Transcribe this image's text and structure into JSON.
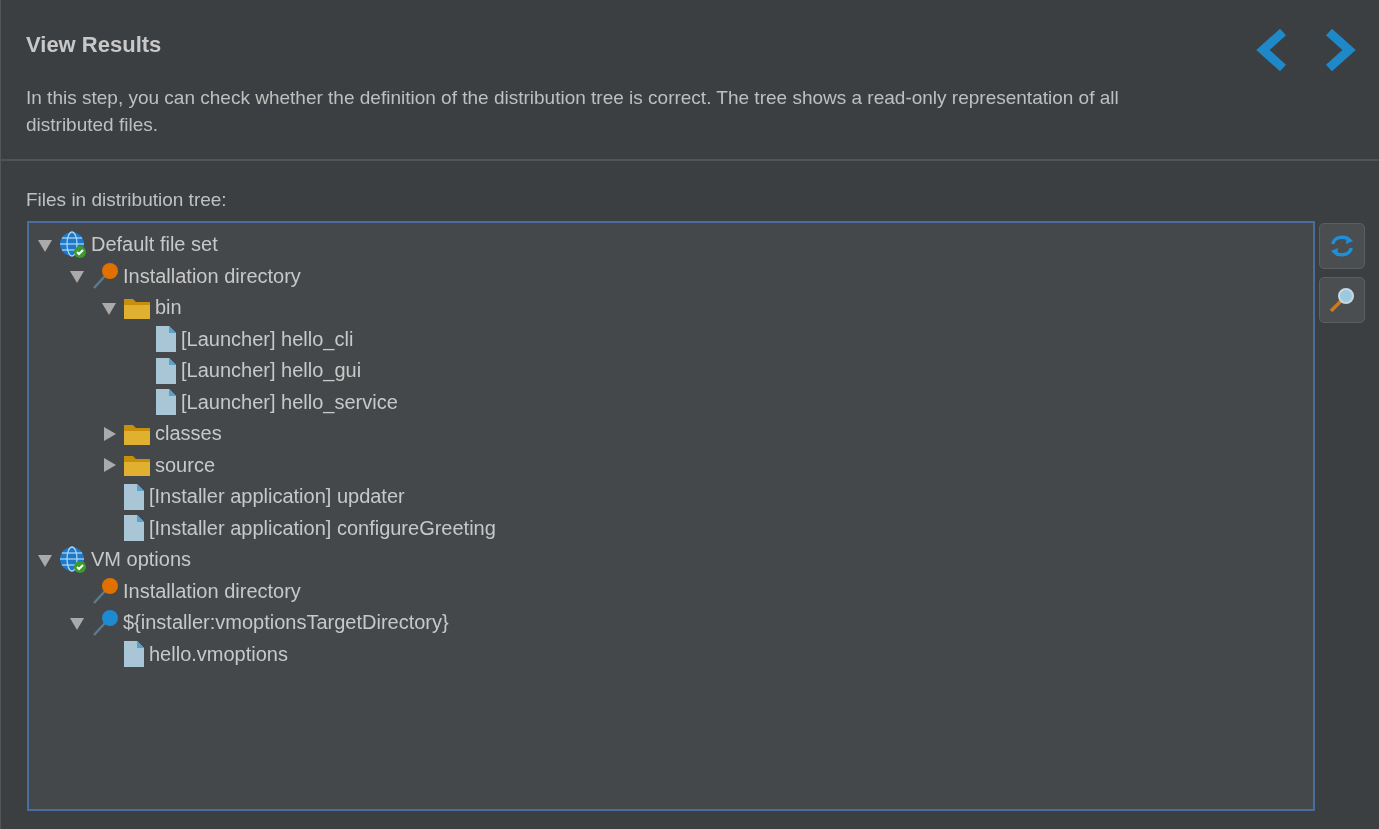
{
  "header": {
    "title": "View Results",
    "description": "In this step, you can check whether the definition of the distribution tree is correct. The tree shows a read-only representation of all distributed files."
  },
  "tree_label": "Files in distribution tree:",
  "tree": [
    {
      "kind": "fileset",
      "label": "Default file set",
      "expanded": true,
      "children": [
        {
          "kind": "directory",
          "color": "#e07000",
          "label": "Installation directory",
          "expanded": true,
          "children": [
            {
              "kind": "folder",
              "label": "bin",
              "expanded": true,
              "children": [
                {
                  "kind": "file",
                  "label": "[Launcher] hello_cli"
                },
                {
                  "kind": "file",
                  "label": "[Launcher] hello_gui"
                },
                {
                  "kind": "file",
                  "label": "[Launcher] hello_service"
                }
              ]
            },
            {
              "kind": "folder",
              "label": "classes",
              "expanded": false
            },
            {
              "kind": "folder",
              "label": "source",
              "expanded": false
            },
            {
              "kind": "file",
              "label": "[Installer application] updater"
            },
            {
              "kind": "file",
              "label": "[Installer application] configureGreeting"
            }
          ]
        }
      ]
    },
    {
      "kind": "fileset",
      "label": "VM options",
      "expanded": true,
      "children": [
        {
          "kind": "directory",
          "color": "#e07000",
          "label": "Installation directory"
        },
        {
          "kind": "directory",
          "color": "#1e8ad0",
          "label": "${installer:vmoptionsTargetDirectory}",
          "expanded": true,
          "children": [
            {
              "kind": "file",
              "label": "hello.vmoptions"
            }
          ]
        }
      ]
    }
  ]
}
